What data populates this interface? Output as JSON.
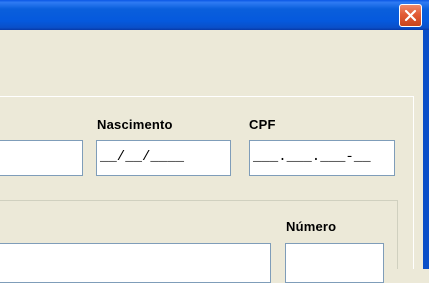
{
  "window": {
    "close_label": "close"
  },
  "form": {
    "nascimento_label": "Nascimento",
    "nascimento_mask": "__/__/____",
    "cpf_label": "CPF",
    "cpf_mask": "___.___.___-__",
    "numero_label": "Número"
  },
  "colors": {
    "titlebar": "#0559dd",
    "close_button": "#e25b35",
    "window_face": "#ece9d8",
    "field_border": "#7f9db9"
  }
}
